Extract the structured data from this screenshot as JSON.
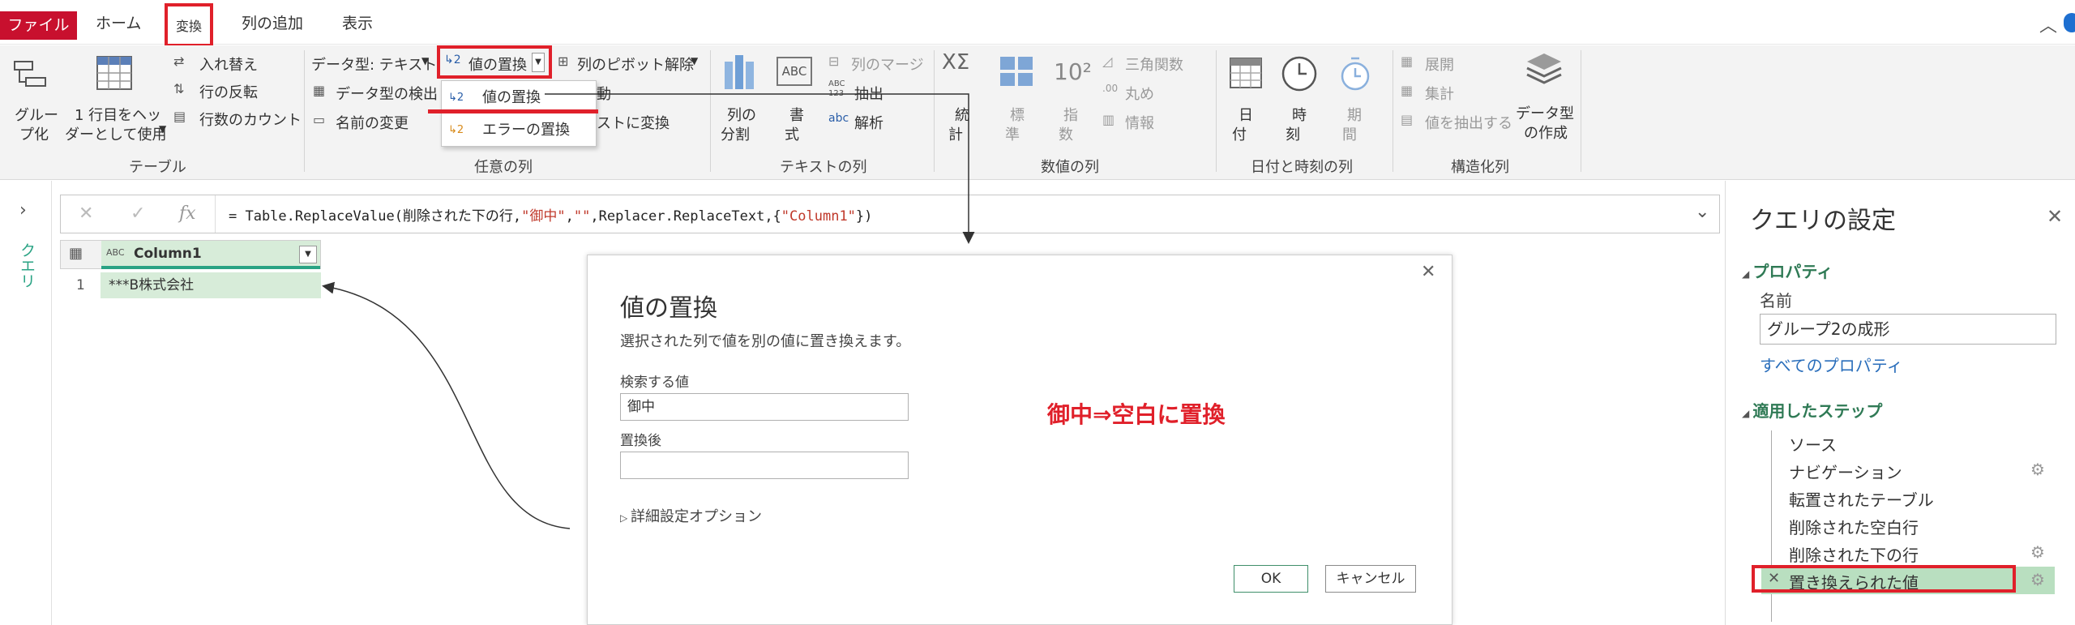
{
  "tabs": [
    "ファイル",
    "ホーム",
    "変換",
    "列の追加",
    "表示"
  ],
  "ribbon": {
    "table_group": {
      "group_by": [
        "グルー",
        "プ化"
      ],
      "first_row": [
        "1 行目をヘッ",
        "ダーとして使用"
      ],
      "transpose": "入れ替え",
      "reverse_rows": "行の反転",
      "count_rows": "行数のカウント",
      "label": "テーブル"
    },
    "any_column": {
      "data_type": "データ型: テキスト",
      "detect_type": "データ型の検出",
      "rename": "名前の変更",
      "replace_values": "値の置換",
      "unpivot": "列のピボット解除",
      "move_partial": "動",
      "to_list_partial": "ストに変換",
      "label": "任意の列"
    },
    "replace_menu": {
      "items": [
        "値の置換",
        "エラーの置換"
      ]
    },
    "text_column": {
      "split": [
        "列の",
        "分割"
      ],
      "format": [
        "書",
        "式"
      ],
      "merge": "列のマージ",
      "extract": "抽出",
      "parse": "解析",
      "abc_glyph": "ABC",
      "abc123_glyph": "ABC 123",
      "label": "テキストの列"
    },
    "number_column": {
      "stats": [
        "統",
        "計"
      ],
      "standard": [
        "標",
        "準"
      ],
      "scientific": [
        "指",
        "数"
      ],
      "trig": "三角関数",
      "round": "丸め",
      "info": "情報",
      "label": "数値の列"
    },
    "datetime_column": {
      "date": [
        "日",
        "付"
      ],
      "time": [
        "時",
        "刻"
      ],
      "duration": [
        "期",
        "間"
      ],
      "label": "日付と時刻の列"
    },
    "structured": {
      "expand": "展開",
      "aggregate": "集計",
      "extract_values": "値を抽出する",
      "create_datatype": [
        "データ型",
        "の作成"
      ],
      "label": "構造化列"
    }
  },
  "queries_label": "クエリ",
  "formula_bar": {
    "prefix": "= Table.ReplaceValue(削除された下の行,",
    "s1": "\"御中\"",
    "c1": ",",
    "s2": "\"\"",
    "mid": ",Replacer.ReplaceText,{",
    "s3": "\"Column1\"",
    "suffix": "})"
  },
  "grid": {
    "type_label": "ABC",
    "column": "Column1",
    "rows": [
      {
        "num": "1",
        "value": "***B株式会社"
      }
    ]
  },
  "dialog": {
    "title": "値の置換",
    "description": "選択された列で値を別の値に置き換えます。",
    "find_label": "検索する値",
    "find_value": "御中",
    "replace_label": "置換後",
    "replace_value": "",
    "advanced": "詳細設定オプション",
    "ok": "OK",
    "cancel": "キャンセル"
  },
  "annotation": "御中⇒空白に置換",
  "query_settings": {
    "title": "クエリの設定",
    "properties": "プロパティ",
    "name_label": "名前",
    "name_value": "グループ2の成形",
    "all_properties": "すべてのプロパティ",
    "applied_steps": "適用したステップ",
    "steps": [
      {
        "label": "ソース",
        "gear": false
      },
      {
        "label": "ナビゲーション",
        "gear": true
      },
      {
        "label": "転置されたテーブル",
        "gear": false
      },
      {
        "label": "削除された空白行",
        "gear": false
      },
      {
        "label": "削除された下の行",
        "gear": true
      },
      {
        "label": "置き換えられた値",
        "gear": true
      }
    ]
  },
  "colors": {
    "accent_red": "#e0202a",
    "file_tab": "#c8102e",
    "selected_green": "#b9dfc0",
    "grid_teal": "#2aa384"
  },
  "icons": [
    "search-icon",
    "close-icon",
    "check-icon",
    "fx-icon",
    "chevron-down-icon",
    "gear-icon",
    "table-icon"
  ]
}
